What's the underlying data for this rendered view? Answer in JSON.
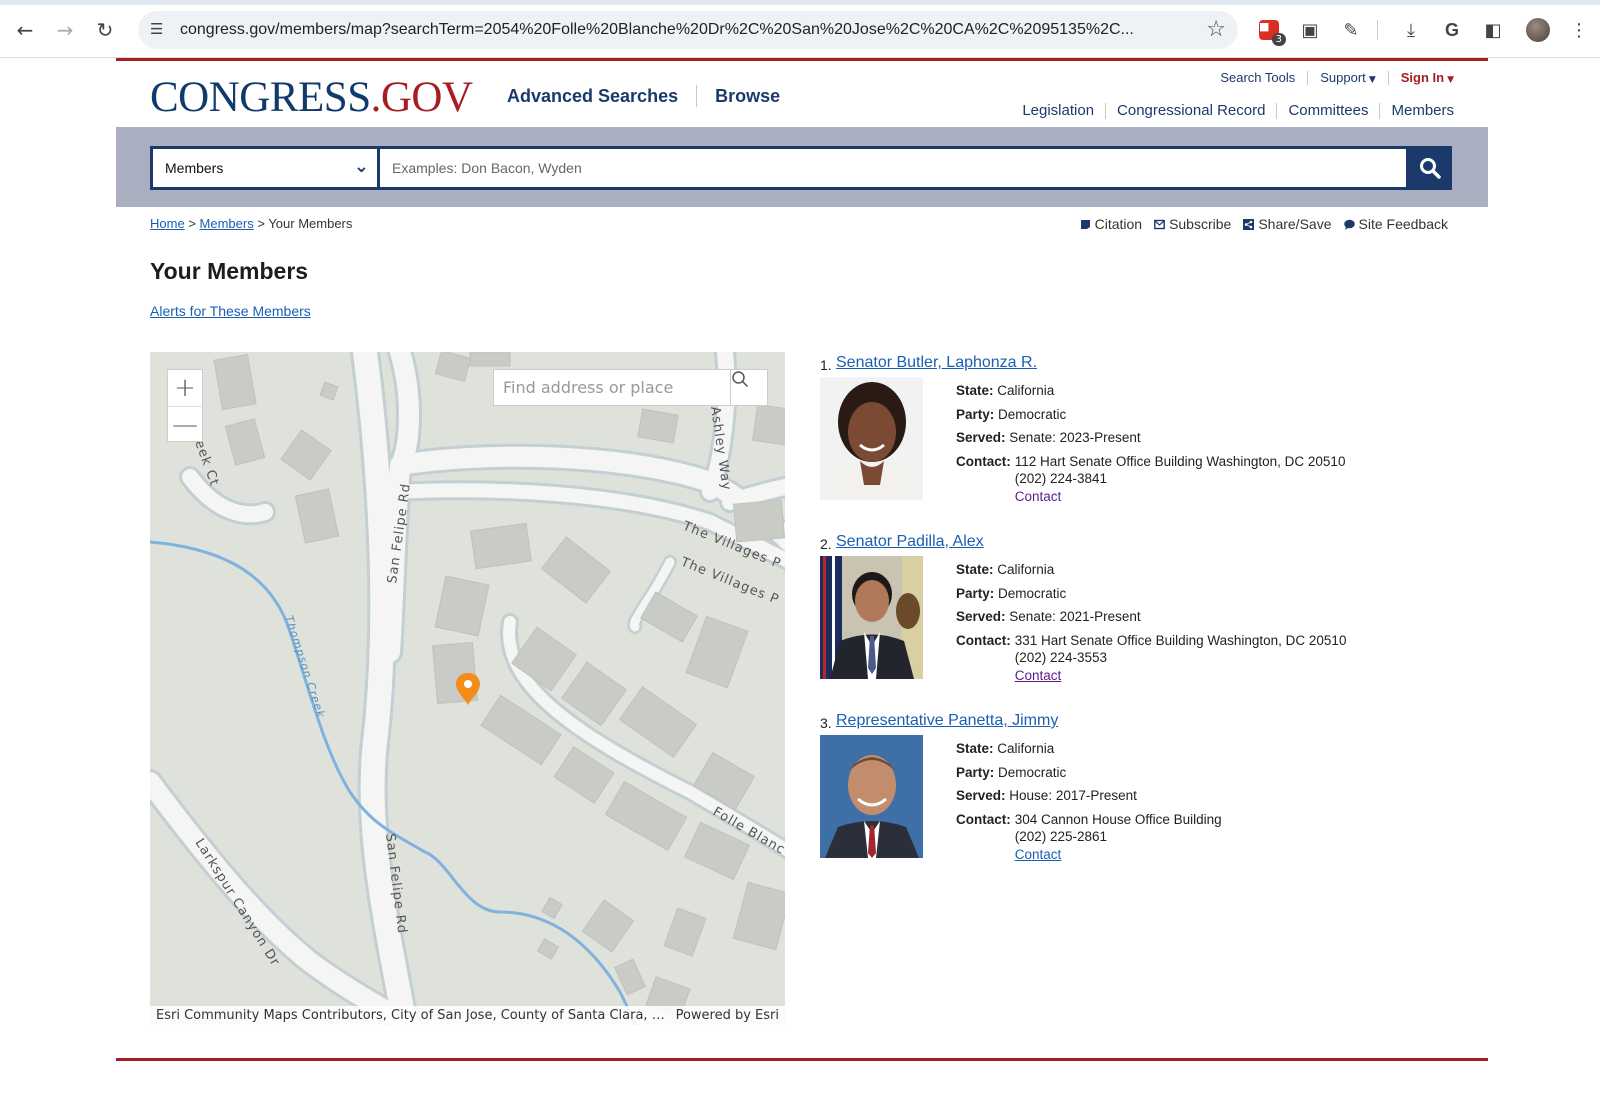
{
  "browser": {
    "url": "congress.gov/members/map?searchTerm=2054%20Folle%20Blanche%20Dr%2C%20San%20Jose%2C%20CA%2C%2095135%2C...",
    "extension_badge": "3"
  },
  "header": {
    "logo_main": "CONGRESS",
    "logo_dot": ".",
    "logo_gov": "GOV",
    "nav": [
      "Advanced Searches",
      "Browse"
    ],
    "util": {
      "search_tools": "Search Tools",
      "support": "Support",
      "sign_in": "Sign In"
    },
    "secondary": [
      "Legislation",
      "Congressional Record",
      "Committees",
      "Members"
    ]
  },
  "search": {
    "collection": "Members",
    "placeholder": "Examples: Don Bacon, Wyden"
  },
  "breadcrumb": {
    "home": "Home",
    "sep1": ">",
    "members": "Members",
    "sep2": ">",
    "current": "Your Members"
  },
  "tools": [
    "Citation",
    "Subscribe",
    "Share/Save",
    "Site Feedback"
  ],
  "page_title": "Your Members",
  "alerts_link": "Alerts for These Members",
  "map": {
    "search_placeholder": "Find address or place",
    "attribution": "Esri Community Maps Contributors, City of San Jose, County of Santa Clara, San...",
    "powered_by": "Powered by Esri",
    "streets": {
      "creek_ct": "eek Ct",
      "san_felipe_1": "San Felipe Rd",
      "san_felipe_2": "San Felipe Rd",
      "ashley": "Ashley Way",
      "villages_1": "The Villages P",
      "villages_2": "The Villages P",
      "thompson": "Thompson Creek",
      "larkspur": "Larkspur Canyon Dr",
      "folle": "Folle Blanc"
    },
    "colors": {
      "land": "#dfe2da",
      "road": "#f5f6f3",
      "water": "#7fb3de",
      "building": "#c9ccc6",
      "marker": "#f28c1b"
    }
  },
  "members": [
    {
      "num": "1.",
      "name": "Senator Butler, Laphonza R.",
      "state_label": "State:",
      "state": "California",
      "party_label": "Party:",
      "party": "Democratic",
      "served_label": "Served:",
      "served": "Senate: 2023-Present",
      "contact_label": "Contact:",
      "address": "112 Hart Senate Office Building Washington, DC 20510",
      "phone": "(202) 224-3841",
      "contact_link": "Contact"
    },
    {
      "num": "2.",
      "name": "Senator Padilla, Alex",
      "state_label": "State:",
      "state": "California",
      "party_label": "Party:",
      "party": "Democratic",
      "served_label": "Served:",
      "served": "Senate: 2021-Present",
      "contact_label": "Contact:",
      "address": "331 Hart Senate Office Building Washington, DC 20510",
      "phone": "(202) 224-3553",
      "contact_link": "Contact"
    },
    {
      "num": "3.",
      "name": "Representative Panetta, Jimmy",
      "state_label": "State:",
      "state": "California",
      "party_label": "Party:",
      "party": "Democratic",
      "served_label": "Served:",
      "served": "House: 2017-Present",
      "contact_label": "Contact:",
      "address": "304 Cannon House Office Building",
      "phone": "(202) 225-2861",
      "contact_link": "Contact"
    }
  ]
}
